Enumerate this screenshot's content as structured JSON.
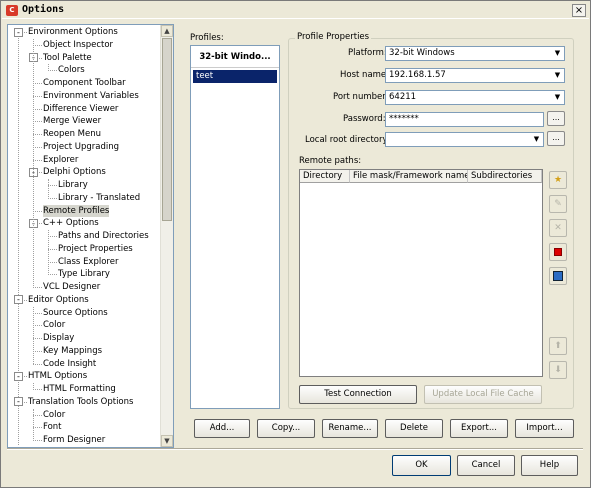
{
  "window": {
    "title": "Options",
    "close": "×"
  },
  "tree": [
    {
      "label": "Environment Options",
      "level": 0,
      "box": "-"
    },
    {
      "label": "Object Inspector",
      "level": 1
    },
    {
      "label": "Tool Palette",
      "level": 1,
      "box": "-"
    },
    {
      "label": "Colors",
      "level": 2
    },
    {
      "label": "Component Toolbar",
      "level": 1
    },
    {
      "label": "Environment Variables",
      "level": 1
    },
    {
      "label": "Difference Viewer",
      "level": 1
    },
    {
      "label": "Merge Viewer",
      "level": 1
    },
    {
      "label": "Reopen Menu",
      "level": 1
    },
    {
      "label": "Project Upgrading",
      "level": 1
    },
    {
      "label": "Explorer",
      "level": 1
    },
    {
      "label": "Delphi Options",
      "level": 1,
      "box": "-"
    },
    {
      "label": "Library",
      "level": 2
    },
    {
      "label": "Library - Translated",
      "level": 2
    },
    {
      "label": "Remote Profiles",
      "level": 1,
      "selected": true
    },
    {
      "label": "C++ Options",
      "level": 1,
      "box": "-"
    },
    {
      "label": "Paths and Directories",
      "level": 2
    },
    {
      "label": "Project Properties",
      "level": 2
    },
    {
      "label": "Class Explorer",
      "level": 2
    },
    {
      "label": "Type Library",
      "level": 2
    },
    {
      "label": "VCL Designer",
      "level": 1
    },
    {
      "label": "Editor Options",
      "level": 0,
      "box": "-"
    },
    {
      "label": "Source Options",
      "level": 1
    },
    {
      "label": "Color",
      "level": 1
    },
    {
      "label": "Display",
      "level": 1
    },
    {
      "label": "Key Mappings",
      "level": 1
    },
    {
      "label": "Code Insight",
      "level": 1
    },
    {
      "label": "HTML Options",
      "level": 0,
      "box": "-"
    },
    {
      "label": "HTML Formatting",
      "level": 1
    },
    {
      "label": "Translation Tools Options",
      "level": 0,
      "box": "-"
    },
    {
      "label": "Color",
      "level": 1
    },
    {
      "label": "Font",
      "level": 1
    },
    {
      "label": "Form Designer",
      "level": 1
    }
  ],
  "profiles": {
    "label": "Profiles:",
    "header": "32-bit Windo...",
    "items": [
      "teet"
    ]
  },
  "props": {
    "group": "Profile Properties",
    "platform_label": "Platform:",
    "platform_value": "32-bit Windows",
    "host_label": "Host name:",
    "host_value": "192.168.1.57",
    "port_label": "Port number:",
    "port_value": "64211",
    "password_label": "Password:",
    "password_value": "*******",
    "root_label": "Local root directory:",
    "root_value": "",
    "ellipsis": "...",
    "remote_label": "Remote paths:",
    "columns": [
      "Directory",
      "File mask/Framework name",
      "Subdirectories"
    ],
    "test_button": "Test Connection",
    "update_button": "Update Local File Cache"
  },
  "buttons": {
    "add": "Add...",
    "copy": "Copy...",
    "rename": "Rename...",
    "delete": "Delete",
    "export": "Export...",
    "import": "Import...",
    "ok": "OK",
    "cancel": "Cancel",
    "help": "Help"
  }
}
